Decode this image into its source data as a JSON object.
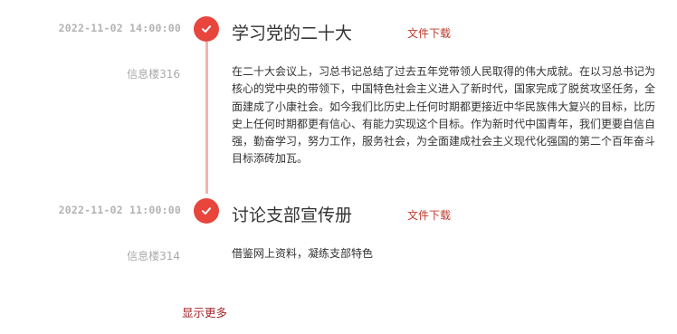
{
  "timeline": {
    "items": [
      {
        "datetime": "2022-11-02 14:00:00",
        "title": "学习党的二十大",
        "download_label": "文件下载",
        "location": "信息楼316",
        "description": "在二十大会议上，习总书记总结了过去五年党带领人民取得的伟大成就。在以习总书记为核心的党中央的带领下，中国特色社会主义进入了新时代，国家完成了脱贫攻坚任务，全面建成了小康社会。如今我们比历史上任何时期都更接近中华民族伟大复兴的目标，比历史上任何时期都更有信心、有能力实现这个目标。作为新时代中国青年，我们更要自信自强，勤奋学习，努力工作，服务社会，为全面建成社会主义现代化强国的第二个百年奋斗目标添砖加瓦。"
      },
      {
        "datetime": "2022-11-02 11:00:00",
        "title": "讨论支部宣传册",
        "download_label": "文件下载",
        "location": "信息楼314",
        "description": "借鉴网上资料，凝练支部特色"
      }
    ],
    "show_more_label": "显示更多",
    "node_icon": "check-icon"
  },
  "colors": {
    "accent": "#e8453c",
    "link": "#c0392b",
    "line": "#f2b3b0",
    "muted": "#b3b3b3"
  }
}
